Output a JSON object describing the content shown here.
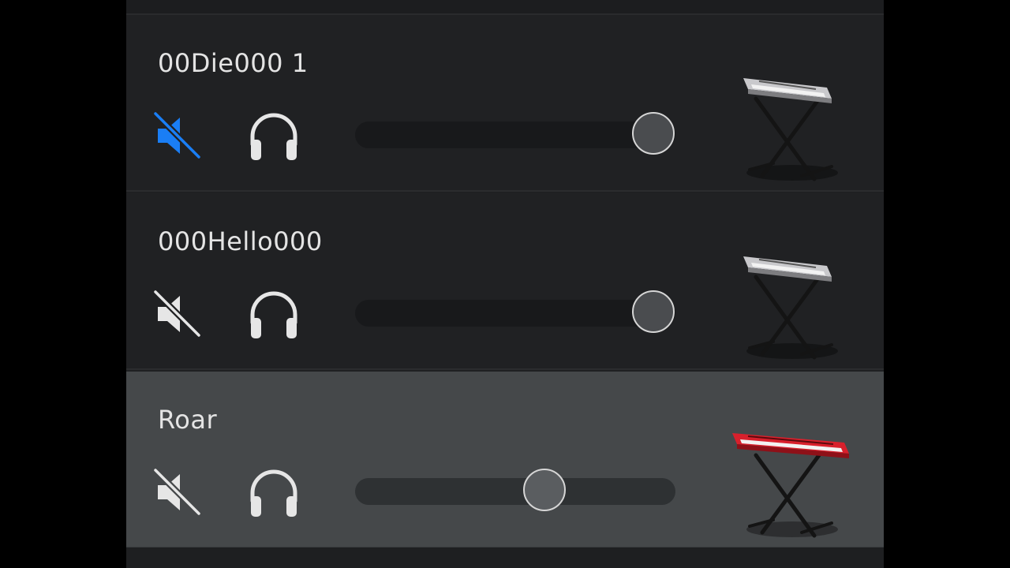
{
  "tracks": [
    {
      "name": "00Die000 1",
      "muted": true,
      "volume": 0.93,
      "selected": false,
      "instrument_icon": "keyboard-stand-icon",
      "keyboard_color": "#c9c9cc",
      "mute_color": "#1a7ef5"
    },
    {
      "name": "000Hello000",
      "muted": false,
      "volume": 0.93,
      "selected": false,
      "instrument_icon": "keyboard-stand-icon",
      "keyboard_color": "#c9c9cc",
      "mute_color": "#e6e6e6"
    },
    {
      "name": "Roar",
      "muted": false,
      "volume": 0.59,
      "selected": true,
      "instrument_icon": "red-keyboard-stand-icon",
      "keyboard_color": "#d8202c",
      "mute_color": "#e6e6e6"
    }
  ],
  "colors": {
    "accent": "#1a7ef5",
    "icon": "#e6e6e6"
  }
}
